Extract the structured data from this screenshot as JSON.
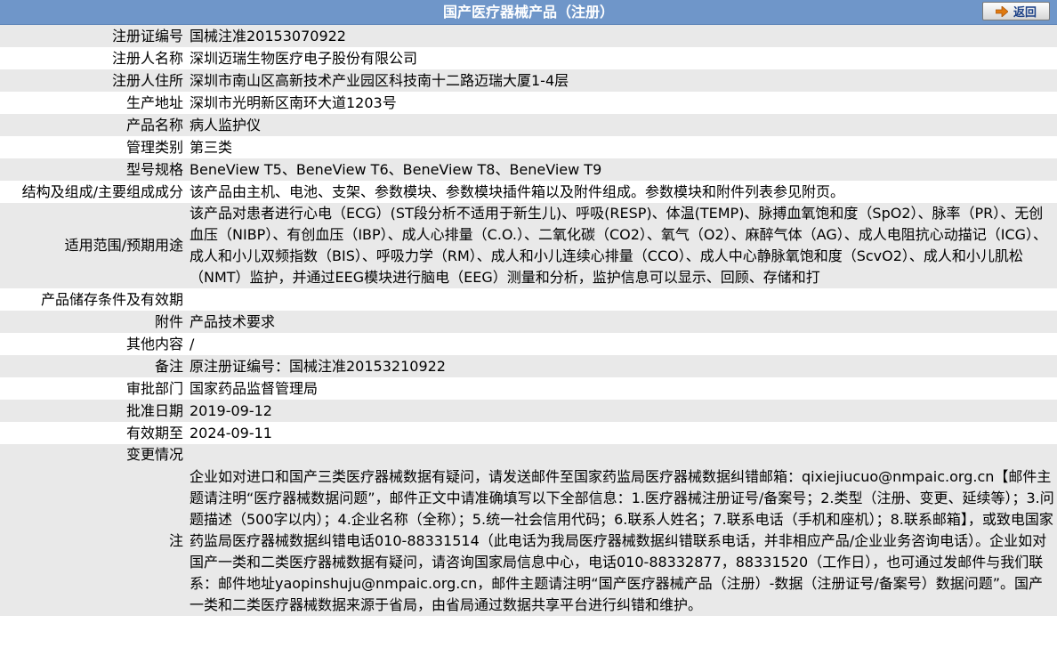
{
  "header": {
    "title": "国产医疗器械产品（注册）",
    "back_label": "返回"
  },
  "rows": {
    "reg_no": {
      "label": "注册证编号",
      "value": "国械注准20153070922"
    },
    "registrant": {
      "label": "注册人名称",
      "value": "深圳迈瑞生物医疗电子股份有限公司"
    },
    "address": {
      "label": "注册人住所",
      "value": "深圳市南山区高新技术产业园区科技南十二路迈瑞大厦1-4层"
    },
    "production_address": {
      "label": "生产地址",
      "value": "深圳市光明新区南环大道1203号"
    },
    "product_name": {
      "label": "产品名称",
      "value": "病人监护仪"
    },
    "class": {
      "label": "管理类别",
      "value": "第三类"
    },
    "model": {
      "label": "型号规格",
      "value": "BeneView T5、BeneView T6、BeneView T8、BeneView T9"
    },
    "structure": {
      "label": "结构及组成/主要组成成分",
      "value": "该产品由主机、电池、支架、参数模块、参数模块插件箱以及附件组成。参数模块和附件列表参见附页。"
    },
    "intended_use": {
      "label": "适用范围/预期用途",
      "value": "该产品对患者进行心电（ECG）(ST段分析不适用于新生儿)、呼吸(RESP)、体温(TEMP)、脉搏血氧饱和度（SpO2）、脉率（PR）、无创血压（NIBP）、有创血压（IBP）、成人心排量（C.O.）、二氧化碳（CO2）、氧气（O2）、麻醉气体（AG）、成人电阻抗心动描记（ICG）、成人和小儿双频指数（BIS）、呼吸力学（RM）、成人和小儿连续心排量（CCO）、成人中心静脉氧饱和度（ScvO2）、成人和小儿肌松（NMT）监护，并通过EEG模块进行脑电（EEG）测量和分析，监护信息可以显示、回顾、存储和打"
    },
    "storage": {
      "label": "产品储存条件及有效期",
      "value": ""
    },
    "attachment": {
      "label": "附件",
      "value": "产品技术要求"
    },
    "other": {
      "label": "其他内容",
      "value": "/"
    },
    "remark": {
      "label": "备注",
      "value": "原注册证编号：国械注准20153210922"
    },
    "department": {
      "label": "审批部门",
      "value": "国家药品监督管理局"
    },
    "approval_date": {
      "label": "批准日期",
      "value": "2019-09-12"
    },
    "expiry_date": {
      "label": "有效期至",
      "value": "2024-09-11"
    },
    "change": {
      "label": "变更情况",
      "value": ""
    },
    "note": {
      "label": "注",
      "value": "企业如对进口和国产三类医疗器械数据有疑问，请发送邮件至国家药监局医疗器械数据纠错邮箱：qixiejiucuo@nmpaic.org.cn【邮件主题请注明“医疗器械数据问题”，邮件正文中请准确填写以下全部信息：1.医疗器械注册证号/备案号；2.类型（注册、变更、延续等）；3.问题描述（500字以内）；4.企业名称（全称）；5.统一社会信用代码；6.联系人姓名；7.联系电话（手机和座机）；8.联系邮箱】，或致电国家药监局医疗器械数据纠错电话010-88331514（此电话为我局医疗器械数据纠错联系电话，并非相应产品/企业业务咨询电话）。企业如对国产一类和二类医疗器械数据有疑问，请咨询国家局信息中心，电话010-88332877，88331520（工作日），也可通过发邮件与我们联系：邮件地址yaopinshuju@nmpaic.org.cn，邮件主题请注明“国产医疗器械产品（注册）-数据（注册证号/备案号）数据问题”。国产一类和二类医疗器械数据来源于省局，由省局通过数据共享平台进行纠错和维护。"
    }
  },
  "colors": {
    "header_bg": "#6f96c9",
    "row_alt_bg": "#e9e9e9",
    "back_text": "#1a3f86",
    "back_arrow": "#e07a10"
  },
  "icons": {
    "back": "arrow-right-icon"
  }
}
